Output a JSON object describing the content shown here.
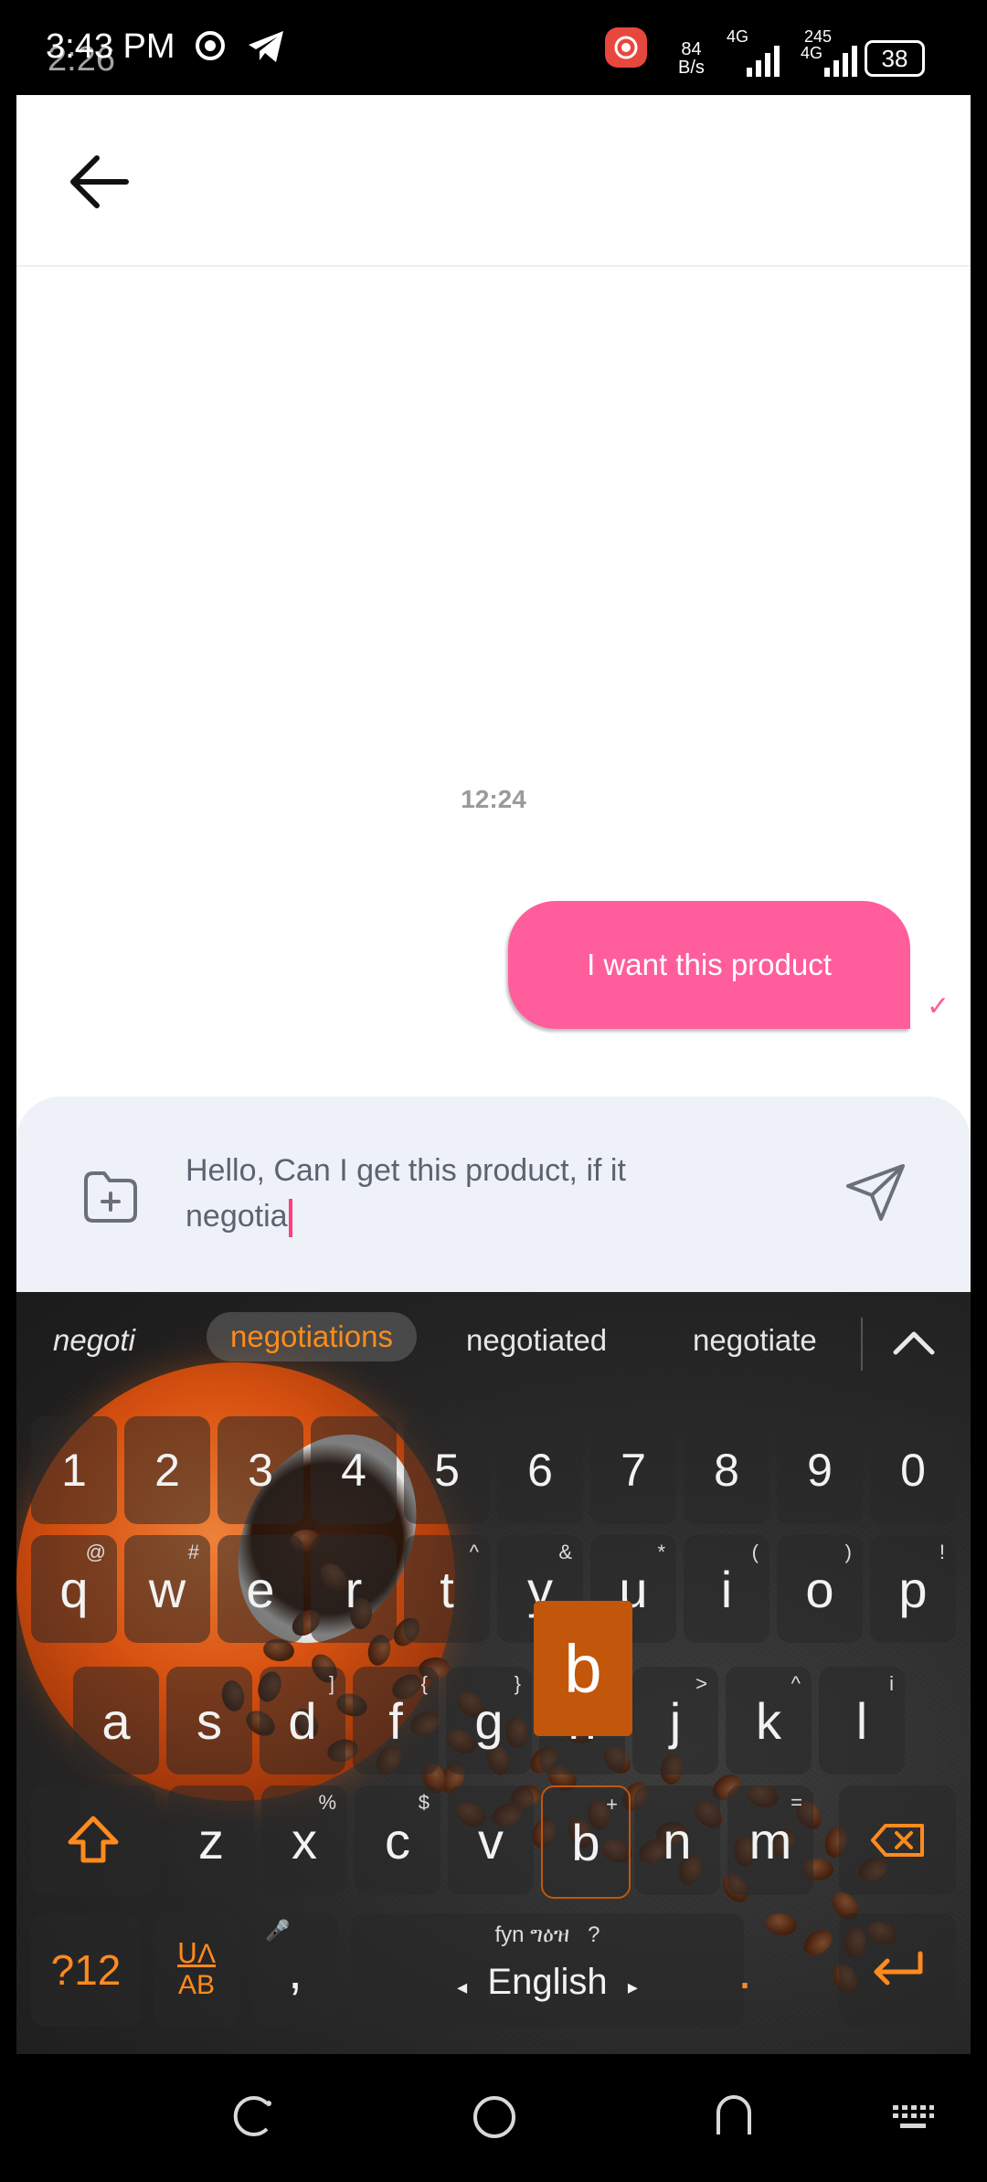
{
  "status_bar": {
    "time": "3:43 PM",
    "overlay_time": "2:26",
    "net_speed_top": "84",
    "net_speed_unit": "B/s",
    "sim1": "4G",
    "sim2": "4G",
    "sim2_speed": "245",
    "battery": "38"
  },
  "chat": {
    "timestamp": "12:24",
    "message_text": "I want this product",
    "input_text": "Hello, Can I get this product, if it negotia"
  },
  "keyboard": {
    "suggestions": [
      "negoti",
      "negotiations",
      "negotiated",
      "negotiate"
    ],
    "number_row": [
      "1",
      "2",
      "3",
      "4",
      "5",
      "6",
      "7",
      "8",
      "9",
      "0"
    ],
    "row1": [
      {
        "k": "q",
        "h": "@"
      },
      {
        "k": "w",
        "h": "#"
      },
      {
        "k": "e",
        "h": ""
      },
      {
        "k": "r",
        "h": ""
      },
      {
        "k": "t",
        "h": "^"
      },
      {
        "k": "y",
        "h": "&"
      },
      {
        "k": "u",
        "h": "*"
      },
      {
        "k": "i",
        "h": "("
      },
      {
        "k": "o",
        "h": ")"
      },
      {
        "k": "p",
        "h": "!"
      }
    ],
    "row2": [
      {
        "k": "a",
        "h": ""
      },
      {
        "k": "s",
        "h": ""
      },
      {
        "k": "d",
        "h": "]"
      },
      {
        "k": "f",
        "h": "{"
      },
      {
        "k": "g",
        "h": "}"
      },
      {
        "k": "h",
        "h": ""
      },
      {
        "k": "j",
        "h": ">"
      },
      {
        "k": "k",
        "h": "^"
      },
      {
        "k": "l",
        "h": "i"
      }
    ],
    "row3": [
      {
        "k": "z",
        "h": ""
      },
      {
        "k": "x",
        "h": "%"
      },
      {
        "k": "c",
        "h": "$"
      },
      {
        "k": "v",
        "h": ""
      },
      {
        "k": "b",
        "h": "+"
      },
      {
        "k": "n",
        "h": ""
      },
      {
        "k": "m",
        "h": "="
      }
    ],
    "symbols_key": "?12",
    "lang_switch_top": "ՍΛ",
    "lang_switch_bottom": "AB",
    "comma_key": ",",
    "space_label": "English",
    "space_hint": "fyn ግዕዝ",
    "space_hint2": "?",
    "period_key": ".",
    "popup_letter": "b"
  },
  "colors": {
    "accent_pink": "#ff5d9b",
    "keyboard_accent": "#ff8a1e"
  }
}
